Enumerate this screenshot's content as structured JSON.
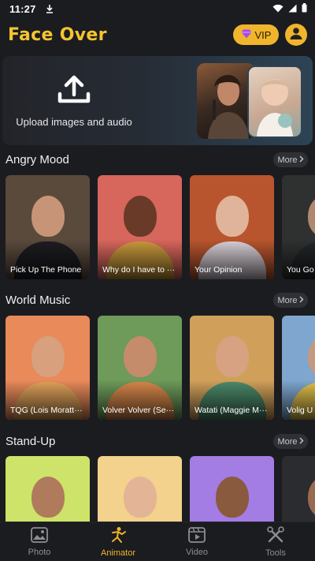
{
  "status_bar": {
    "time": "11:27"
  },
  "header": {
    "title": "Face Over",
    "vip_label": "VIP"
  },
  "upload": {
    "label": "Upload images and audio"
  },
  "sections": [
    {
      "title": "Angry Mood",
      "more": "More",
      "cards": [
        {
          "caption": "Pick Up The Phone",
          "bg": "#5a4a3c",
          "skin": "#c89478",
          "cloth": "#1c1c22"
        },
        {
          "caption": "Why do I have to ···",
          "bg": "#d7665c",
          "skin": "#6a3a28",
          "cloth": "#c99a3c"
        },
        {
          "caption": "Your Opinion",
          "bg": "#b8552e",
          "skin": "#e0b49a",
          "cloth": "#d9cfd8"
        },
        {
          "caption": "You Go",
          "bg": "#2f3130",
          "skin": "#b08870",
          "cloth": "#22262a"
        }
      ]
    },
    {
      "title": "World Music",
      "more": "More",
      "cards": [
        {
          "caption": "TQG (Lois Moratt···",
          "bg": "#e88a5a",
          "skin": "#d8a07c",
          "cloth": "#e0a25a"
        },
        {
          "caption": "Volver Volver (Se···",
          "bg": "#6e9a5a",
          "skin": "#c48c6a",
          "cloth": "#d8874a"
        },
        {
          "caption": "Watati (Maggie M···",
          "bg": "#d0a05a",
          "skin": "#d7a282",
          "cloth": "#4c8a6a"
        },
        {
          "caption": "Volig U",
          "bg": "#7ea6cf",
          "skin": "#c49a7e",
          "cloth": "#e3c24a"
        }
      ]
    },
    {
      "title": "Stand-Up",
      "more": "More",
      "cards": [
        {
          "caption": "",
          "bg": "#cde36a",
          "skin": "#b07a5c",
          "cloth": "#1e1e22"
        },
        {
          "caption": "",
          "bg": "#f2d28c",
          "skin": "#e3b496",
          "cloth": "#3a2a24"
        },
        {
          "caption": "",
          "bg": "#a37de3",
          "skin": "#8a5a3e",
          "cloth": "#2a2a30"
        },
        {
          "caption": "",
          "bg": "#2a2c30",
          "skin": "#9a6a4e",
          "cloth": "#1e1f22"
        }
      ]
    }
  ],
  "nav": [
    {
      "label": "Photo",
      "icon": "image-icon",
      "active": false
    },
    {
      "label": "Animator",
      "icon": "dancer-icon",
      "active": true
    },
    {
      "label": "Video",
      "icon": "play-film-icon",
      "active": false
    },
    {
      "label": "Tools",
      "icon": "tools-icon",
      "active": false
    }
  ],
  "colors": {
    "accent": "#f0b52c",
    "title": "#f5c431",
    "background": "#1b1c20"
  }
}
